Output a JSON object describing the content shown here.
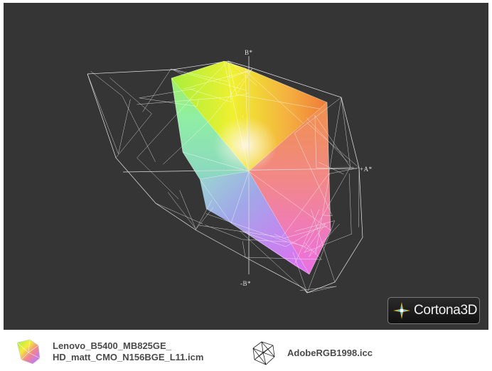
{
  "viewer": {
    "axes": {
      "b_positive": "B*",
      "a_positive": "+A*",
      "b_negative": "-B*"
    },
    "badge": {
      "brand": "Cortona3D"
    }
  },
  "legend": {
    "items": [
      {
        "label": "Lenovo_B5400_MB825GE_\nHD_matt_CMO_N156BGE_L11.icm",
        "icon": "color-gamut-solid-icon"
      },
      {
        "label": "AdobeRGB1998.icc",
        "icon": "wireframe-gamut-icon"
      }
    ]
  },
  "colors": {
    "viewport_bg": "#353535",
    "wireframe": "#ffffff",
    "legend_text": "#4a4a4a"
  }
}
